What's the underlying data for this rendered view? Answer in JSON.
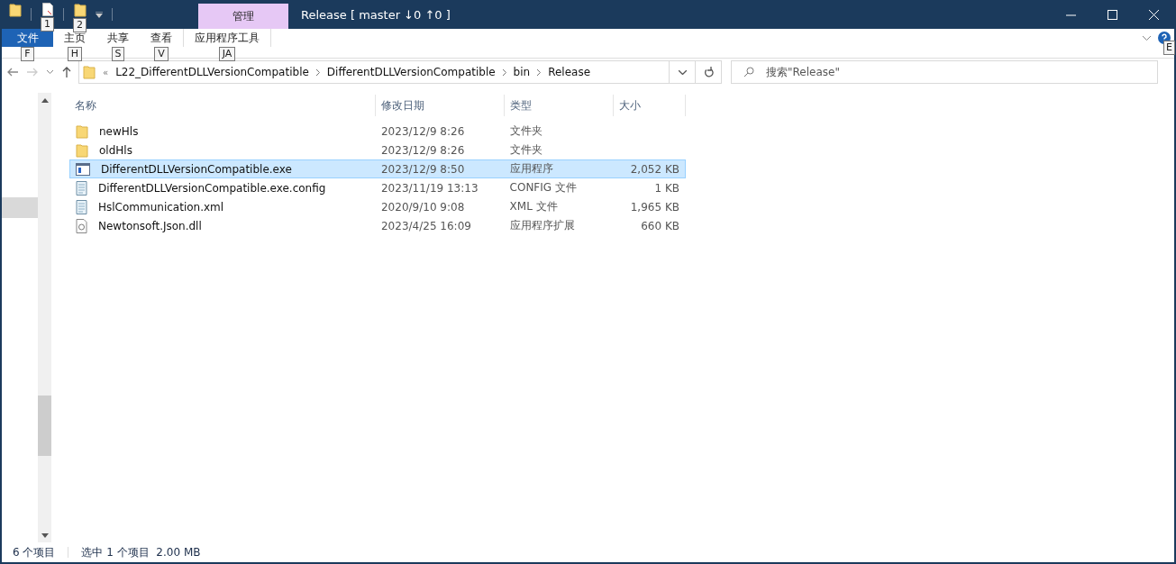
{
  "window": {
    "title": "Release [ master ↓0 ↑0 ]",
    "context_tab_group": "管理"
  },
  "quick_access": [
    {
      "kind": "folder"
    },
    {
      "kind": "properties",
      "keytip": "1"
    },
    {
      "kind": "new-folder",
      "keytip": "2"
    }
  ],
  "ribbon_tabs": [
    {
      "label": "文件",
      "keytip": "F",
      "kind": "file",
      "selected": false
    },
    {
      "label": "主页",
      "keytip": "H",
      "kind": "tab",
      "selected": false
    },
    {
      "label": "共享",
      "keytip": "S",
      "kind": "tab",
      "selected": false
    },
    {
      "label": "查看",
      "keytip": "V",
      "kind": "tab",
      "selected": false
    },
    {
      "label": "应用程序工具",
      "keytip": "JA",
      "kind": "context",
      "selected": false
    }
  ],
  "help_keytip": "E",
  "address": {
    "overflow": "«",
    "crumbs": [
      "L22_DifferentDLLVersionCompatible",
      "DifferentDLLVersionCompatible",
      "bin",
      "Release"
    ]
  },
  "search": {
    "placeholder": "搜索\"Release\""
  },
  "table": {
    "columns": [
      "名称",
      "修改日期",
      "类型",
      "大小"
    ],
    "rows": [
      {
        "name": "newHls",
        "date": "2023/12/9 8:26",
        "type": "文件夹",
        "kind": "folder",
        "selected": false
      },
      {
        "name": "oldHls",
        "date": "2023/12/9 8:26",
        "type": "文件夹",
        "kind": "folder",
        "selected": false
      },
      {
        "name": "DifferentDLLVersionCompatible.exe",
        "date": "2023/12/9 8:50",
        "type": "应用程序",
        "size": "2,052 KB",
        "kind": "exe",
        "selected": true
      },
      {
        "name": "DifferentDLLVersionCompatible.exe.config",
        "date": "2023/11/19 13:13",
        "type": "CONFIG 文件",
        "size": "1 KB",
        "kind": "doc",
        "selected": false
      },
      {
        "name": "HslCommunication.xml",
        "date": "2020/9/10 9:08",
        "type": "XML 文件",
        "size": "1,965 KB",
        "kind": "doc",
        "selected": false
      },
      {
        "name": "Newtonsoft.Json.dll",
        "date": "2023/4/25 16:09",
        "type": "应用程序扩展",
        "size": "660 KB",
        "kind": "dll",
        "selected": false
      }
    ]
  },
  "status_bar": {
    "count": "6 个项目",
    "selection": "选中 1 个项目  2.00 MB"
  }
}
